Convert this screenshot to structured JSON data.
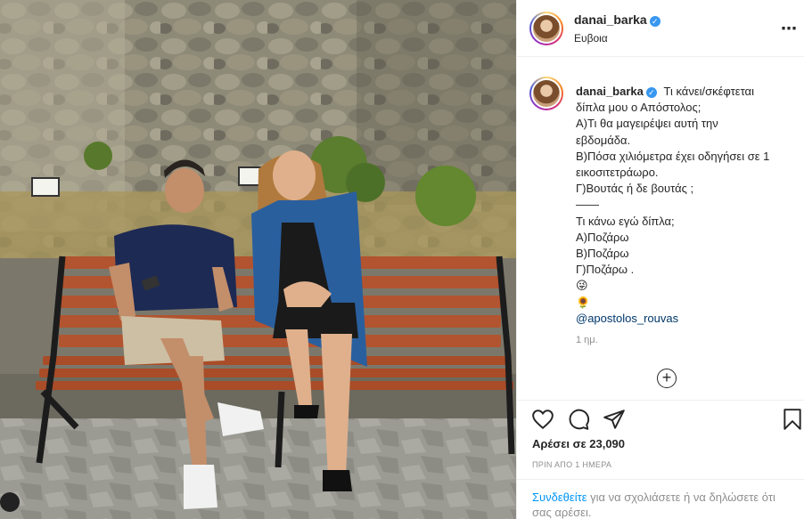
{
  "post": {
    "username": "danai_barka",
    "verified_mark": "✓",
    "location": "Ευβοια",
    "more_icon": "⋯",
    "caption_lines": [
      "Τι κάνει/σκέφτεται",
      "δίπλα μου ο Απόστολος;",
      "Α)Τι θα μαγειρέψει αυτή την",
      "εβδομάδα.",
      "Β)Πόσα χιλιόμετρα έχει οδηγήσει σε 1",
      "εικοσιτετράωρο.",
      "Γ)Βουτάς ή δε βουτάς ;",
      "——",
      "Τι κάνω εγώ δίπλα;",
      "Α)Ποζάρω",
      "Β)Ποζάρω",
      "Γ)Ποζάρω ."
    ],
    "emoji_1": "😜",
    "emoji_2": "🌻",
    "mention": "@apostolos_rouvas",
    "time_ago": "1 ημ.",
    "load_more_icon": "+",
    "likes_text": "Αρέσει σε 23,090",
    "date_text": "ΠΡΙΝ ΑΠΟ 1 ΗΜΕΡΑ",
    "login_link": "Συνδεθείτε",
    "login_rest": " για να σχολιάσετε ή να δηλώσετε ότι σας αρέσει."
  },
  "icons": {
    "like": "heart-icon",
    "comment": "comment-icon",
    "share": "paper-plane-icon",
    "save": "bookmark-icon"
  },
  "colors": {
    "link": "#0095f6",
    "mention": "#00376b",
    "verified": "#3897f0",
    "muted": "#8e8e8e"
  }
}
